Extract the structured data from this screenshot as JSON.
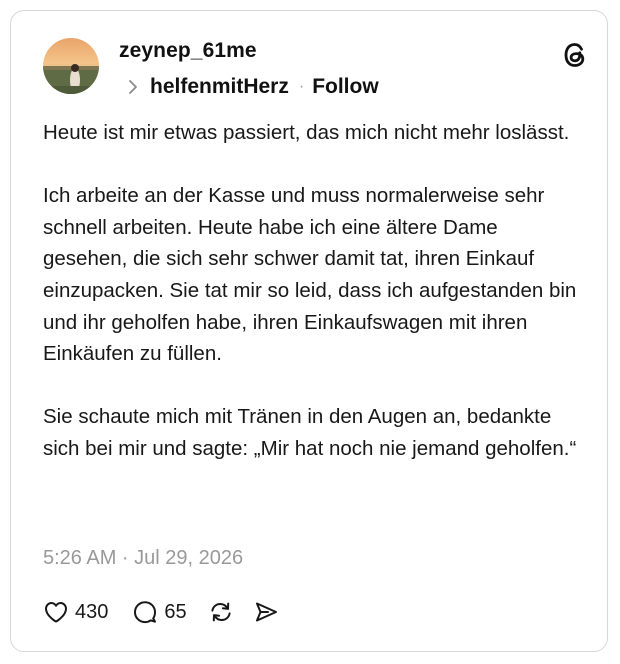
{
  "post": {
    "author": "zeynep_61me",
    "reply_to": "helfenmitHerz",
    "separator": "·",
    "follow_label": "Follow",
    "paragraphs": [
      "Heute ist mir etwas passiert, das mich nicht mehr loslässt.",
      "Ich arbeite an der Kasse und muss normalerweise sehr schnell arbeiten. Heute habe ich eine ältere Dame gesehen, die sich sehr schwer damit tat, ihren Einkauf einzupacken. Sie tat mir so leid, dass ich aufgestanden bin und ihr geholfen habe, ihren Einkaufswagen mit ihren Einkäufen zu füllen.",
      "Sie schaute mich mit Tränen in den Augen an, bedankte sich bei mir und sagte: „Mir hat noch nie jemand geholfen.“"
    ],
    "timestamp": "5:26 AM · Jul 29, 2026"
  },
  "actions": {
    "likes": "430",
    "replies": "65"
  },
  "icons": {
    "brand": "threads-logo-icon",
    "like": "heart-icon",
    "reply": "comment-bubble-icon",
    "repost": "repost-icon",
    "share": "send-icon",
    "reply_indicator": "chevron-right-icon"
  },
  "colors": {
    "text": "#181818",
    "muted": "#999999",
    "border": "#d7d7d7"
  }
}
